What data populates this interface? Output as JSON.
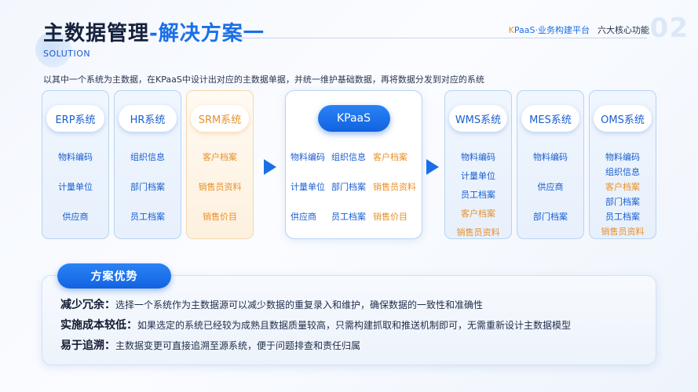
{
  "header": {
    "title_main": "主数据管理",
    "title_accent": "-解决方案一",
    "subtitle": "SOLUTION",
    "platform_k": "K",
    "platform_rest": "PaaS·业务构建平台",
    "feature": "六大核心功能",
    "page_number": "02"
  },
  "intro": "以其中一个系统为主数据，在KPaaS中设计出对应的主数据单据，并统一维护基础数据，再将数据分发到对应的系统",
  "source_systems": [
    {
      "name": "ERP系统",
      "items": [
        "物料编码",
        "计量单位",
        "供应商"
      ]
    },
    {
      "name": "HR系统",
      "items": [
        "组织信息",
        "部门档案",
        "员工档案"
      ]
    },
    {
      "name": "SRM系统",
      "items": [
        "客户档案",
        "销售员资料",
        "销售价目"
      ]
    }
  ],
  "kpaas": {
    "name": "KPaaS",
    "rows": [
      [
        "物料编码",
        "组织信息",
        "客户档案"
      ],
      [
        "计量单位",
        "部门档案",
        "销售员资料"
      ],
      [
        "供应商",
        "员工档案",
        "销售价目"
      ]
    ]
  },
  "target_systems": [
    {
      "name": "WMS系统",
      "items": [
        "物料编码",
        "计量单位",
        "员工档案",
        "客户档案",
        "销售员资料"
      ]
    },
    {
      "name": "MES系统",
      "items": [
        "物料编码",
        "供应商",
        "部门档案"
      ]
    },
    {
      "name": "OMS系统",
      "items": [
        "物料编码",
        "组织信息",
        "客户档案",
        "部门档案",
        "员工档案",
        "销售员资料"
      ]
    }
  ],
  "advantages": {
    "tag": "方案优势",
    "items": [
      {
        "label": "减少冗余：",
        "text": "选择一个系统作为主数据源可以减少数据的重复录入和维护，确保数据的一致性和准确性"
      },
      {
        "label": "实施成本较低：",
        "text": "如果选定的系统已经较为成熟且数据质量较高，只需构建抓取和推送机制即可，无需重新设计主数据模型"
      },
      {
        "label": "易于追溯：",
        "text": "主数据变更可直接追溯至源系统，便于问题排查和责任归属"
      }
    ]
  },
  "colors": {
    "accent": "#1a6fe8",
    "orange": "#e8902a"
  }
}
